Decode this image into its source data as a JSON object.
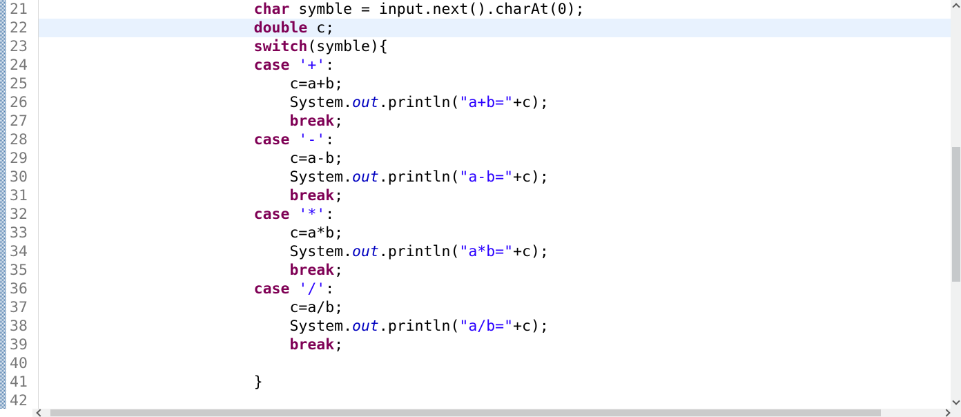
{
  "editor": {
    "current_line": 22,
    "colors": {
      "keyword": "#7F0055",
      "literal": "#2A00FF",
      "static_field": "#0000C0",
      "plain": "#000000",
      "line_number": "#787878",
      "current_line_bg": "#E8F2FE",
      "marker_strip_checker": "#4d7dae"
    },
    "lines": [
      {
        "number": 21,
        "indent": 24,
        "segments": [
          {
            "c": "keyword",
            "t": "char"
          },
          {
            "c": "plain",
            "t": " symble = input.next().charAt(0);"
          }
        ]
      },
      {
        "number": 22,
        "indent": 24,
        "segments": [
          {
            "c": "keyword",
            "t": "double"
          },
          {
            "c": "plain",
            "t": " c;"
          }
        ]
      },
      {
        "number": 23,
        "indent": 24,
        "segments": [
          {
            "c": "keyword",
            "t": "switch"
          },
          {
            "c": "plain",
            "t": "(symble){"
          }
        ]
      },
      {
        "number": 24,
        "indent": 24,
        "segments": [
          {
            "c": "keyword",
            "t": "case"
          },
          {
            "c": "plain",
            "t": " "
          },
          {
            "c": "literal",
            "t": "'+'"
          },
          {
            "c": "plain",
            "t": ":"
          }
        ]
      },
      {
        "number": 25,
        "indent": 28,
        "segments": [
          {
            "c": "plain",
            "t": "c=a+b;"
          }
        ]
      },
      {
        "number": 26,
        "indent": 28,
        "segments": [
          {
            "c": "plain",
            "t": "System."
          },
          {
            "c": "field",
            "t": "out"
          },
          {
            "c": "plain",
            "t": ".println("
          },
          {
            "c": "literal",
            "t": "\"a+b=\""
          },
          {
            "c": "plain",
            "t": "+c);"
          }
        ]
      },
      {
        "number": 27,
        "indent": 28,
        "segments": [
          {
            "c": "keyword",
            "t": "break"
          },
          {
            "c": "plain",
            "t": ";"
          }
        ]
      },
      {
        "number": 28,
        "indent": 24,
        "segments": [
          {
            "c": "keyword",
            "t": "case"
          },
          {
            "c": "plain",
            "t": " "
          },
          {
            "c": "literal",
            "t": "'-'"
          },
          {
            "c": "plain",
            "t": ":"
          }
        ]
      },
      {
        "number": 29,
        "indent": 28,
        "segments": [
          {
            "c": "plain",
            "t": "c=a-b;"
          }
        ]
      },
      {
        "number": 30,
        "indent": 28,
        "segments": [
          {
            "c": "plain",
            "t": "System."
          },
          {
            "c": "field",
            "t": "out"
          },
          {
            "c": "plain",
            "t": ".println("
          },
          {
            "c": "literal",
            "t": "\"a-b=\""
          },
          {
            "c": "plain",
            "t": "+c);"
          }
        ]
      },
      {
        "number": 31,
        "indent": 28,
        "segments": [
          {
            "c": "keyword",
            "t": "break"
          },
          {
            "c": "plain",
            "t": ";"
          }
        ]
      },
      {
        "number": 32,
        "indent": 24,
        "segments": [
          {
            "c": "keyword",
            "t": "case"
          },
          {
            "c": "plain",
            "t": " "
          },
          {
            "c": "literal",
            "t": "'*'"
          },
          {
            "c": "plain",
            "t": ":"
          }
        ]
      },
      {
        "number": 33,
        "indent": 28,
        "segments": [
          {
            "c": "plain",
            "t": "c=a*b;"
          }
        ]
      },
      {
        "number": 34,
        "indent": 28,
        "segments": [
          {
            "c": "plain",
            "t": "System."
          },
          {
            "c": "field",
            "t": "out"
          },
          {
            "c": "plain",
            "t": ".println("
          },
          {
            "c": "literal",
            "t": "\"a*b=\""
          },
          {
            "c": "plain",
            "t": "+c);"
          }
        ]
      },
      {
        "number": 35,
        "indent": 28,
        "segments": [
          {
            "c": "keyword",
            "t": "break"
          },
          {
            "c": "plain",
            "t": ";"
          }
        ]
      },
      {
        "number": 36,
        "indent": 24,
        "segments": [
          {
            "c": "keyword",
            "t": "case"
          },
          {
            "c": "plain",
            "t": " "
          },
          {
            "c": "literal",
            "t": "'/'"
          },
          {
            "c": "plain",
            "t": ":"
          }
        ]
      },
      {
        "number": 37,
        "indent": 28,
        "segments": [
          {
            "c": "plain",
            "t": "c=a/b;"
          }
        ]
      },
      {
        "number": 38,
        "indent": 28,
        "segments": [
          {
            "c": "plain",
            "t": "System."
          },
          {
            "c": "field",
            "t": "out"
          },
          {
            "c": "plain",
            "t": ".println("
          },
          {
            "c": "literal",
            "t": "\"a/b=\""
          },
          {
            "c": "plain",
            "t": "+c);"
          }
        ]
      },
      {
        "number": 39,
        "indent": 28,
        "segments": [
          {
            "c": "keyword",
            "t": "break"
          },
          {
            "c": "plain",
            "t": ";"
          }
        ]
      },
      {
        "number": 40,
        "indent": 0,
        "segments": []
      },
      {
        "number": 41,
        "indent": 24,
        "segments": [
          {
            "c": "plain",
            "t": "}"
          }
        ]
      },
      {
        "number": 42,
        "indent": 0,
        "segments": []
      }
    ]
  },
  "scrollbars": {
    "vertical": {
      "up_icon": "scroll-up-icon",
      "down_icon": "scroll-down-icon"
    },
    "horizontal": {
      "left_icon": "scroll-left-icon",
      "right_icon": "scroll-right-icon"
    }
  }
}
